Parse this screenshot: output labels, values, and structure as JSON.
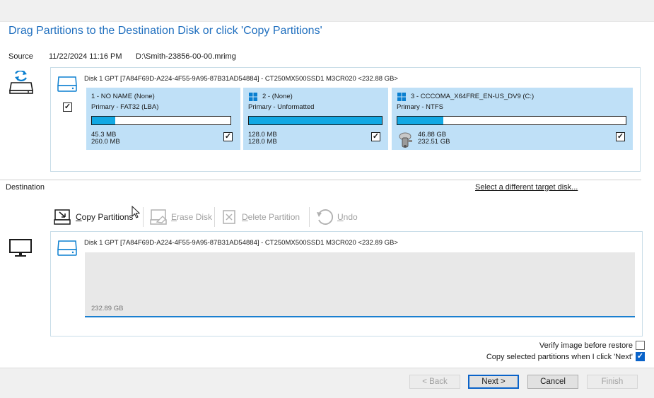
{
  "title": "Drag Partitions to the Destination Disk or click 'Copy Partitions'",
  "source": {
    "label": "Source",
    "date": "11/22/2024 11:16 PM",
    "path": "D:\\Smith-23856-00-00.mrimg",
    "disk_header": "Disk 1 GPT [7A84F69D-A224-4F55-9A95-87B31AD54884] - CT250MX500SSD1 M3CR020  <232.88 GB>",
    "partitions": [
      {
        "name": "1 - NO NAME (None)",
        "type": "Primary - FAT32 (LBA)",
        "used": "45.3 MB",
        "total": "260.0 MB",
        "fill_fraction": 0.17
      },
      {
        "name": "2 -  (None)",
        "type": "Primary - Unformatted",
        "used": "128.0 MB",
        "total": "128.0 MB",
        "fill_fraction": 1.0
      },
      {
        "name": "3 - CCCOMA_X64FRE_EN-US_DV9 (C:)",
        "type": "Primary - NTFS",
        "used": "46.88 GB",
        "total": "232.51 GB",
        "fill_fraction": 0.2
      }
    ]
  },
  "destination": {
    "label": "Destination",
    "target_link": "Select a different target disk...",
    "disk_header": "Disk 1 GPT [7A84F69D-A224-4F55-9A95-87B31AD54884] - CT250MX500SSD1 M3CR020  <232.89 GB>",
    "unallocated_size": "232.89 GB"
  },
  "toolbar": {
    "copy": "Copy Partitions",
    "erase": "Erase Disk",
    "delete": "Delete Partition",
    "undo": "Undo"
  },
  "options": {
    "verify": "Verify image before restore",
    "copy_selected": "Copy selected partitions when I click 'Next'"
  },
  "buttons": {
    "back": "< Back",
    "next": "Next >",
    "cancel": "Cancel",
    "finish": "Finish"
  },
  "colors": {
    "accent": "#1f6fbf",
    "partition_bg": "#bfe0f7",
    "bar_fill": "#12a8e3",
    "checkbox_blue": "#0a63c9"
  }
}
